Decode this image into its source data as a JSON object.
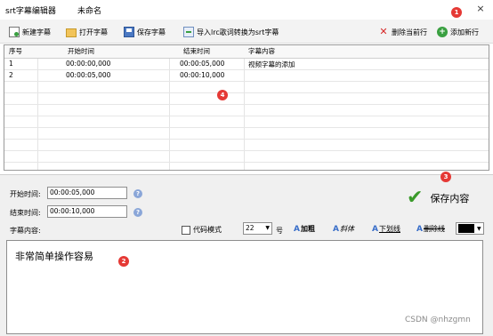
{
  "window": {
    "title": "srt字幕编辑器",
    "document_name": "未命名",
    "close_glyph": "×"
  },
  "toolbar": {
    "new_subtitle": "新建字幕",
    "open_subtitle": "打开字幕",
    "save_subtitle": "保存字幕",
    "import_lrc": "导入lrc歌词转换为srt字幕",
    "delete_row": "删除当前行",
    "add_row": "添加新行"
  },
  "grid": {
    "columns": [
      "序号",
      "开始时间",
      "结束时间",
      "字幕内容"
    ],
    "rows": [
      {
        "index": "1",
        "start": "00:00:00,000",
        "end": "00:00:05,000",
        "text": "视频字幕的添加"
      },
      {
        "index": "2",
        "start": "00:00:05,000",
        "end": "00:00:10,000",
        "text": ""
      }
    ]
  },
  "editor": {
    "start_label": "开始时间:",
    "start_value": "00:00:05,000",
    "end_label": "结束时间:",
    "end_value": "00:00:10,000",
    "save_content": "保存内容",
    "content_label": "字幕内容:",
    "code_mode_label": "代码模式",
    "font_size_value": "22",
    "font_size_unit": "号",
    "bold_label": "加粗",
    "italic_label": "斜体",
    "underline_label": "下划线",
    "strike_label": "删除线",
    "text_color": "#000000",
    "content_text": "非常简单操作容易"
  },
  "markers": [
    "1",
    "2",
    "3",
    "4"
  ],
  "watermark": "CSDN @nhzgmn",
  "icons": {
    "new": "new-file-icon",
    "open": "folder-icon",
    "save": "floppy-icon",
    "import": "import-icon",
    "delete": "red-x-icon",
    "add": "green-plus-icon",
    "save_content": "green-check-icon",
    "help": "help-icon"
  },
  "colors": {
    "marker": "#e53935",
    "delete_x": "#d62828",
    "add_plus": "#3aa041",
    "check": "#3a9a2a"
  }
}
